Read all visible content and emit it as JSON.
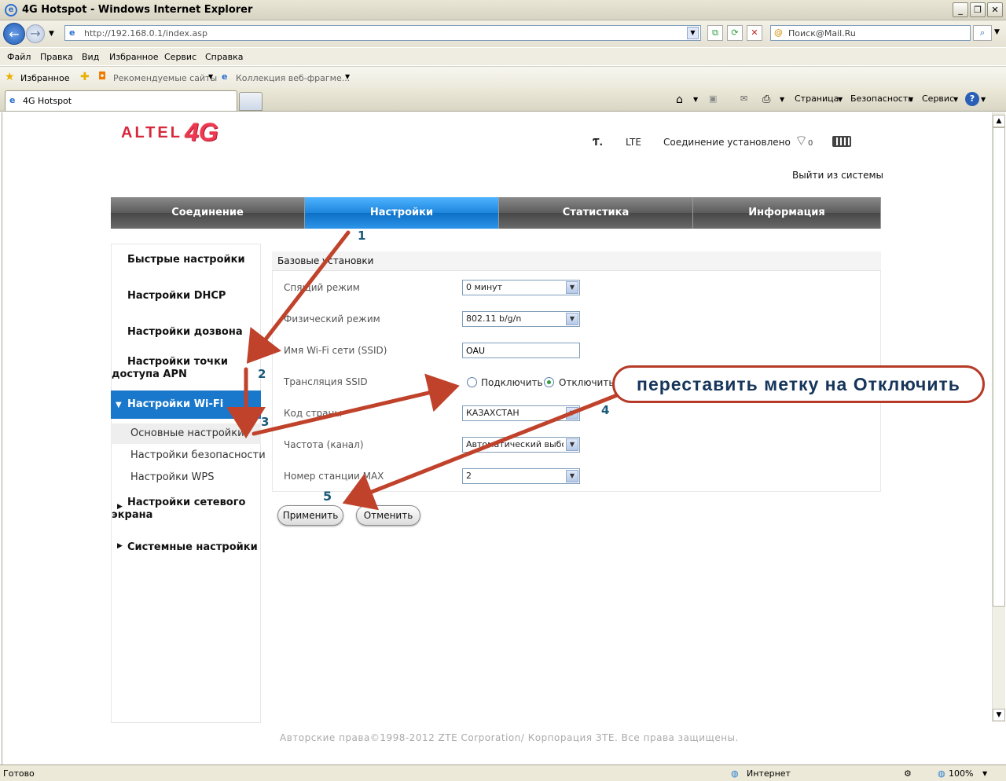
{
  "window": {
    "title": "4G Hotspot - Windows Internet Explorer",
    "url": "http://192.168.0.1/index.asp",
    "search_placeholder": "Поиск@Mail.Ru"
  },
  "menu": [
    "Файл",
    "Правка",
    "Вид",
    "Избранное",
    "Сервис",
    "Справка"
  ],
  "favorites": {
    "label": "Избранное",
    "items": [
      "Рекомендуемые сайты",
      "Коллекция веб-фрагме..."
    ]
  },
  "tab": {
    "label": "4G Hotspot"
  },
  "commands": {
    "page": "Страница",
    "safety": "Безопасность",
    "service": "Сервис"
  },
  "header": {
    "logo_text": "ALTEL",
    "logo_4g": "4G",
    "network": "LTE",
    "connection": "Соединение установлено",
    "signal_sub": "0",
    "logout": "Выйти из системы"
  },
  "nav": [
    "Соединение",
    "Настройки",
    "Статистика",
    "Информация"
  ],
  "sidebar": {
    "items": [
      {
        "label": "Быстрые настройки"
      },
      {
        "label": "Настройки DHCP"
      },
      {
        "label": "Настройки дозвона"
      },
      {
        "label_line1": "Настройки точки",
        "label_line2": "доступа APN"
      },
      {
        "label": "Настройки Wi-Fi"
      },
      {
        "label_line1": "Настройки сетевого",
        "label_line2": "экрана"
      },
      {
        "label": "Системные настройки"
      }
    ],
    "subitems": [
      "Основные настройки",
      "Настройки безопасности",
      "Настройки WPS"
    ]
  },
  "form": {
    "section_title": "Базовые установки",
    "sleep_label": "Спящий режим",
    "sleep_value": "0 минут",
    "mode_label": "Физический режим",
    "mode_value": "802.11 b/g/n",
    "ssid_label": "Имя Wi-Fi сети (SSID)",
    "ssid_value": "OAU",
    "broadcast_label": "Трансляция SSID",
    "broadcast_on": "Подключить",
    "broadcast_off": "Отключить",
    "country_label": "Код страны",
    "country_value": "КАЗАХСТАН",
    "channel_label": "Частота (канал)",
    "channel_value": "Автоматический выбо",
    "max_label": "Номер станции MAX",
    "max_value": "2",
    "apply": "Применить",
    "cancel": "Отменить"
  },
  "footer": "Авторские права©1998-2012 ZTE Corporation/ Корпорация ЗТЕ. Все права защищены.",
  "annotation": {
    "callout": "переставить метку на Отключить",
    "steps": [
      "1",
      "2",
      "3",
      "4",
      "5"
    ]
  },
  "statusbar": {
    "left": "Готово",
    "zone": "Интернет",
    "zoom": "100%"
  }
}
